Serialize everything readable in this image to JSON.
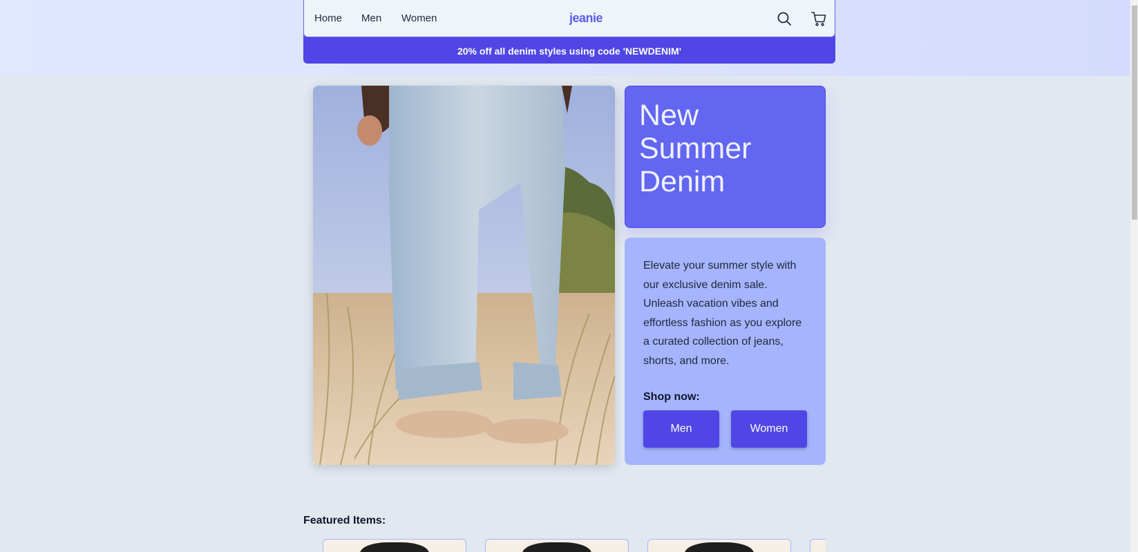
{
  "nav": {
    "links": [
      "Home",
      "Men",
      "Women"
    ],
    "logo": "jeanie",
    "icons": [
      "search-icon",
      "cart-icon"
    ]
  },
  "promo": {
    "text": "20% off all denim styles using code 'NEWDENIM'"
  },
  "hero": {
    "image_subject": "jeans-on-beach",
    "title_lines": [
      "New",
      "Summer",
      "Denim"
    ],
    "description": "Elevate your summer style with our exclusive denim sale. Unleash vacation vibes and effortless fashion as you explore a curated collection of jeans, shorts, and more.",
    "shop_label": "Shop now:",
    "buttons": [
      "Men",
      "Women"
    ]
  },
  "featured": {
    "title": "Featured Items:"
  },
  "colors": {
    "primary": "#4f46e5",
    "accent": "#6366f1",
    "light_accent": "#a5b4fc",
    "background": "#e2e8f0"
  }
}
